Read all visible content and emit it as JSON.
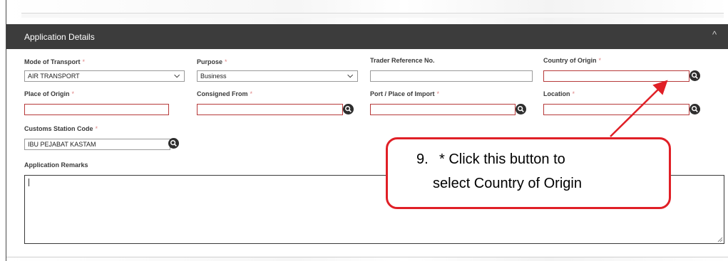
{
  "panel": {
    "title": "Application Details",
    "collapse_glyph": "^"
  },
  "fields": {
    "mode_of_transport": {
      "label": "Mode of Transport",
      "required_mark": "*",
      "value": "AIR TRANSPORT"
    },
    "purpose": {
      "label": "Purpose",
      "required_mark": "*",
      "value": "Business"
    },
    "trader_reference": {
      "label": "Trader Reference No.",
      "value": ""
    },
    "country_of_origin": {
      "label": "Country of Origin",
      "required_mark": "*",
      "value": ""
    },
    "place_of_origin": {
      "label": "Place of Origin",
      "required_mark": "*",
      "value": ""
    },
    "consigned_from": {
      "label": "Consigned From",
      "required_mark": "*",
      "value": ""
    },
    "port_of_import": {
      "label": "Port / Place of Import",
      "required_mark": "*",
      "value": ""
    },
    "location": {
      "label": "Location",
      "required_mark": "*",
      "value": ""
    },
    "customs_station_code": {
      "label": "Customs Station Code",
      "required_mark": "*",
      "value": "IBU PEJABAT KASTAM"
    },
    "application_remarks": {
      "label": "Application Remarks",
      "value": ""
    }
  },
  "callout": {
    "step": "9.",
    "line1": "* Click this button to",
    "line2": "select Country of Origin",
    "border_color": "#e01f26"
  },
  "icons": {
    "search": "search-icon",
    "dropdown": "chevron-down-icon",
    "collapse": "chevron-up-icon"
  },
  "colors": {
    "header_bg": "#3c3c3c",
    "required": "#e08585",
    "error_border": "#b73a3a",
    "annotation": "#e01f26"
  }
}
